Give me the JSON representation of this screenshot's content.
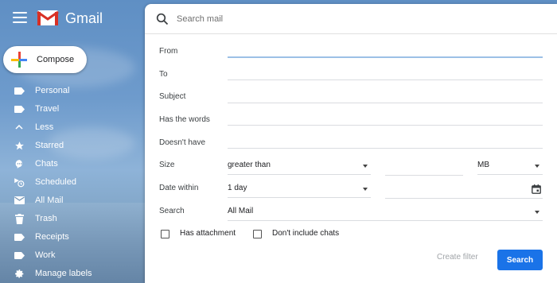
{
  "app": {
    "title": "Gmail"
  },
  "compose": {
    "label": "Compose"
  },
  "sidebar": {
    "items": [
      {
        "label": "Personal",
        "icon": "label-icon"
      },
      {
        "label": "Travel",
        "icon": "label-icon"
      },
      {
        "label": "Less",
        "icon": "chevron-up-icon"
      },
      {
        "label": "Starred",
        "icon": "star-icon"
      },
      {
        "label": "Chats",
        "icon": "chat-icon"
      },
      {
        "label": "Scheduled",
        "icon": "scheduled-icon"
      },
      {
        "label": "All Mail",
        "icon": "mail-icon"
      },
      {
        "label": "Trash",
        "icon": "trash-icon"
      },
      {
        "label": "Receipts",
        "icon": "label-icon"
      },
      {
        "label": "Work",
        "icon": "label-icon"
      },
      {
        "label": "Manage labels",
        "icon": "gear-icon"
      }
    ]
  },
  "search": {
    "placeholder": "Search mail",
    "value": ""
  },
  "filter": {
    "from": {
      "label": "From",
      "value": ""
    },
    "to": {
      "label": "To",
      "value": ""
    },
    "subject": {
      "label": "Subject",
      "value": ""
    },
    "has_words": {
      "label": "Has the words",
      "value": ""
    },
    "doesnt_have": {
      "label": "Doesn't have",
      "value": ""
    },
    "size": {
      "label": "Size",
      "operator": "greater than",
      "value": "",
      "unit": "MB"
    },
    "date_within": {
      "label": "Date within",
      "value": "1 day",
      "date": ""
    },
    "search_in": {
      "label": "Search",
      "value": "All Mail"
    },
    "has_attachment": {
      "label": "Has attachment",
      "checked": false
    },
    "dont_include_chats": {
      "label": "Don't include chats",
      "checked": false
    },
    "create_filter_label": "Create filter",
    "search_button_label": "Search"
  },
  "colors": {
    "accent": "#1a73e8",
    "panel": "#ffffff",
    "sidebar_text": "#ffffff"
  }
}
